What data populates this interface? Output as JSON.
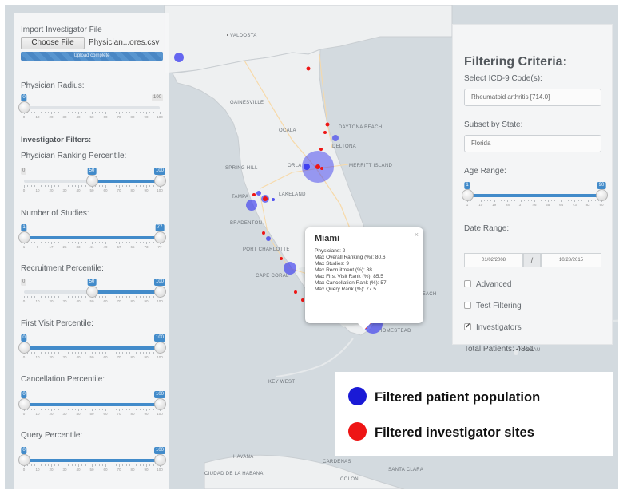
{
  "map": {
    "cities": [
      {
        "name": "VALDOSTA"
      },
      {
        "name": "GAINESVILLE"
      },
      {
        "name": "OCALA"
      },
      {
        "name": "DAYTONA BEACH"
      },
      {
        "name": "DELTONA"
      },
      {
        "name": "SPRING HILL"
      },
      {
        "name": "ORLA"
      },
      {
        "name": "MERRITT ISLAND"
      },
      {
        "name": "TAMPA"
      },
      {
        "name": "LAKELAND"
      },
      {
        "name": "BRADENTON"
      },
      {
        "name": "PORT CHARLOTTE"
      },
      {
        "name": "CAPE CORAL"
      },
      {
        "name": "POMPANO BEACH"
      },
      {
        "name": "HOMESTEAD"
      },
      {
        "name": "KEY WEST"
      },
      {
        "name": "NASSAU"
      },
      {
        "name": "HAVANA"
      },
      {
        "name": "CARDENAS"
      },
      {
        "name": "SANTA CLARA"
      },
      {
        "name": "CIUDAD DE LA HABANA"
      },
      {
        "name": "COLÓN"
      }
    ],
    "colors": {
      "patients": "#1a1ad6",
      "investigators": "#ee1515"
    }
  },
  "left": {
    "import_label": "Import Investigator File",
    "choose_file": "Choose File",
    "file_name": "Physician...ores.csv",
    "upload_status": "Upload complete",
    "upload_progress": 1.0,
    "physician_radius": {
      "label": "Physician Radius:",
      "min": 0,
      "max": 100,
      "value": 0,
      "ticks": [
        "0",
        "10",
        "20",
        "30",
        "40",
        "50",
        "60",
        "70",
        "80",
        "90",
        "100"
      ]
    },
    "investigator_filters": "Investigator Filters:",
    "ranking": {
      "label": "Physician Ranking Percentile:",
      "min": 0,
      "max": 100,
      "from": 50,
      "to": 100,
      "ticks": [
        "0",
        "10",
        "20",
        "30",
        "40",
        "50",
        "60",
        "70",
        "80",
        "90",
        "100"
      ]
    },
    "studies": {
      "label": "Number of Studies:",
      "min": 1,
      "max": 77,
      "from": 1,
      "to": 77,
      "ticks": [
        "1",
        "9",
        "17",
        "25",
        "33",
        "41",
        "49",
        "57",
        "65",
        "73",
        "77"
      ]
    },
    "recruitment": {
      "label": "Recruitment Percentile:",
      "min": 0,
      "max": 100,
      "from": 50,
      "to": 100,
      "ticks": [
        "0",
        "10",
        "20",
        "30",
        "40",
        "50",
        "60",
        "70",
        "80",
        "90",
        "100"
      ]
    },
    "first_visit": {
      "label": "First Visit Percentile:",
      "min": 0,
      "max": 100,
      "from": 0,
      "to": 100,
      "ticks": [
        "0",
        "10",
        "20",
        "30",
        "40",
        "50",
        "60",
        "70",
        "80",
        "90",
        "100"
      ]
    },
    "cancellation": {
      "label": "Cancellation Percentile:",
      "min": 0,
      "max": 100,
      "from": 0,
      "to": 100,
      "ticks": [
        "0",
        "10",
        "20",
        "30",
        "40",
        "50",
        "60",
        "70",
        "80",
        "90",
        "100"
      ]
    },
    "query": {
      "label": "Query Percentile:",
      "min": 0,
      "max": 100,
      "from": 0,
      "to": 100,
      "ticks": [
        "0",
        "10",
        "20",
        "30",
        "40",
        "50",
        "60",
        "70",
        "80",
        "90",
        "100"
      ]
    }
  },
  "right": {
    "title": "Filtering Criteria:",
    "icd_label": "Select ICD-9 Code(s):",
    "icd_value": "Rheumatoid arthritis [714.0]",
    "state_label": "Subset by State:",
    "state_value": "Florida",
    "age_label": "Age Range:",
    "age": {
      "min": 1,
      "max": 90,
      "from": 1,
      "to": 90,
      "ticks": [
        "1",
        "10",
        "19",
        "28",
        "37",
        "46",
        "55",
        "64",
        "73",
        "82",
        "90"
      ]
    },
    "date_label": "Date Range:",
    "date_from": "01/02/2008",
    "date_sep": "/",
    "date_to": "10/28/2015",
    "advanced": {
      "label": "Advanced",
      "checked": false
    },
    "test_filtering": {
      "label": "Test Filtering",
      "checked": false
    },
    "investigators": {
      "label": "Investigators",
      "checked": true
    },
    "total_patients": "Total Patients: 4851"
  },
  "popup": {
    "title": "Miami",
    "close": "×",
    "lines": [
      "Physicians: 2",
      "Max Overall Ranking (%): 80.6",
      "Max Studies: 9",
      "Max Recruitment (%): 88",
      "Max First Visit Rank (%): 85.5",
      "Max Cancellation Rank (%): 57",
      "Max Query Rank (%): 77.5"
    ]
  },
  "legend": {
    "patients": "Filtered patient population",
    "investigators": "Filtered investigator sites"
  }
}
